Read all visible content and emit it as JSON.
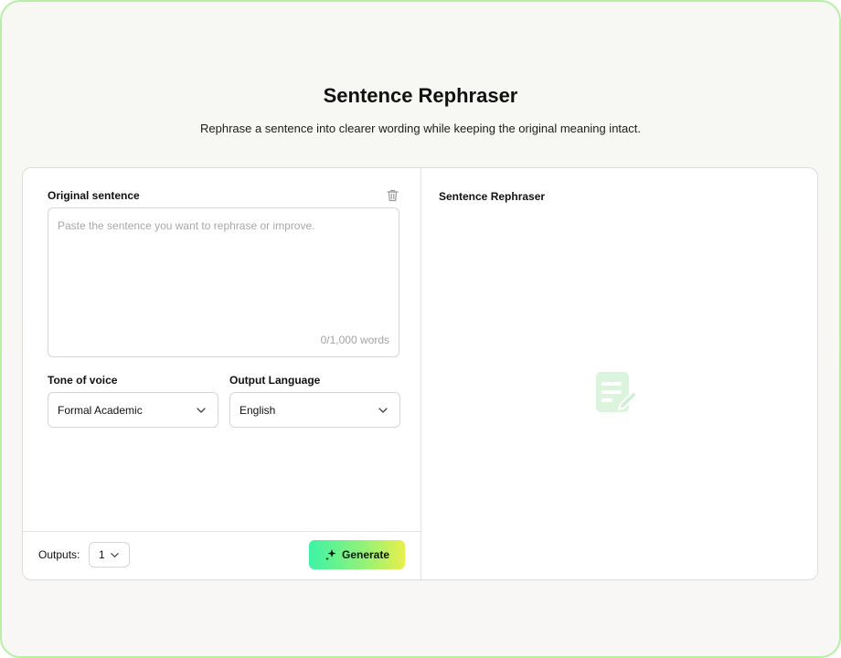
{
  "header": {
    "title": "Sentence Rephraser",
    "subtitle": "Rephrase a sentence into clearer wording while keeping the original meaning intact."
  },
  "input_panel": {
    "original_label": "Original sentence",
    "textarea_value": "",
    "textarea_placeholder": "Paste the sentence you want to rephrase or improve.",
    "word_count": "0/1,000 words",
    "tone": {
      "label": "Tone of voice",
      "selected": "Formal Academic"
    },
    "language": {
      "label": "Output Language",
      "selected": "English"
    },
    "icons": {
      "clear": "trash-icon",
      "dropdown": "chevron-down-icon"
    }
  },
  "footer": {
    "outputs_label": "Outputs:",
    "outputs_value": "1",
    "generate_label": "Generate",
    "generate_icon": "sparkle-icon"
  },
  "output_panel": {
    "title": "Sentence Rephraser",
    "empty_icon": "document-edit-icon"
  },
  "colors": {
    "frame_border": "#b6f0a4",
    "generate_gradient_start": "#3ef3a6",
    "generate_gradient_end": "#e8f04a",
    "empty_icon": "#dcf3de"
  }
}
